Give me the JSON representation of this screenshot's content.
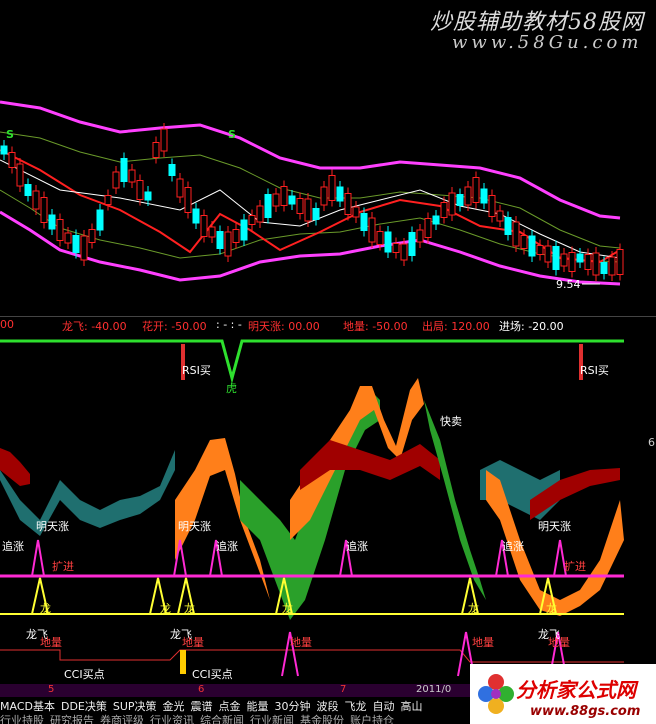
{
  "watermark": {
    "title": "炒股辅助教材58股网",
    "url": "www.58Gu.com"
  },
  "header": {
    "left_value": "00",
    "indicators": [
      {
        "label": "龙飞: -40.00",
        "color": "#ff3030"
      },
      {
        "label": "花开: -50.00",
        "color": "#ff3030"
      },
      {
        "label": ": - : -",
        "color": "#ffffff"
      },
      {
        "label": "明天涨: 00.00",
        "color": "#ff3030"
      },
      {
        "label": "地量: -50.00",
        "color": "#ff3030"
      },
      {
        "label": "出局: 120.00",
        "color": "#ff3030"
      },
      {
        "label": "进场: -20.00",
        "color": "#ffffff"
      }
    ]
  },
  "price_panel": {
    "last_low_label": "9.54"
  },
  "signals": {
    "rsi_buy": "RSI买",
    "tiger": "虎",
    "sell_fast": "快卖",
    "tomorrow_up": "明天涨",
    "chase": "追涨",
    "expand": "扩进",
    "dragon": "龙",
    "dragon_fly": "龙飞",
    "ground": "地量",
    "cci_buy": "CCI买点",
    "right_edge_value": "6"
  },
  "axis": {
    "labels": [
      "5",
      "6",
      "7",
      "2011/0"
    ]
  },
  "tabs": {
    "row1": [
      "MACD基本",
      "DDE决策",
      "SUP决策",
      "金光",
      "震谱",
      "点金",
      "能量",
      "30分钟",
      "波段",
      "飞龙",
      "自动",
      "高山"
    ],
    "row2": [
      "行业持股",
      "研究报告",
      "券商评级",
      "行业资讯",
      "综合新闻",
      "行业新闻",
      "基金股份",
      "账户持仓"
    ]
  },
  "logo": {
    "name": "分析家公式网",
    "url": "www.88gs.com"
  },
  "colors": {
    "bg": "#000000",
    "up": "#ff2020",
    "down": "#00ffff",
    "band": "#ff40ff",
    "orange": "#ff7f1a",
    "green": "#2aa02a",
    "darkred": "#a00000",
    "teal": "#1f6f6f",
    "yellow": "#ffff33",
    "magenta": "#ff2ad4"
  }
}
